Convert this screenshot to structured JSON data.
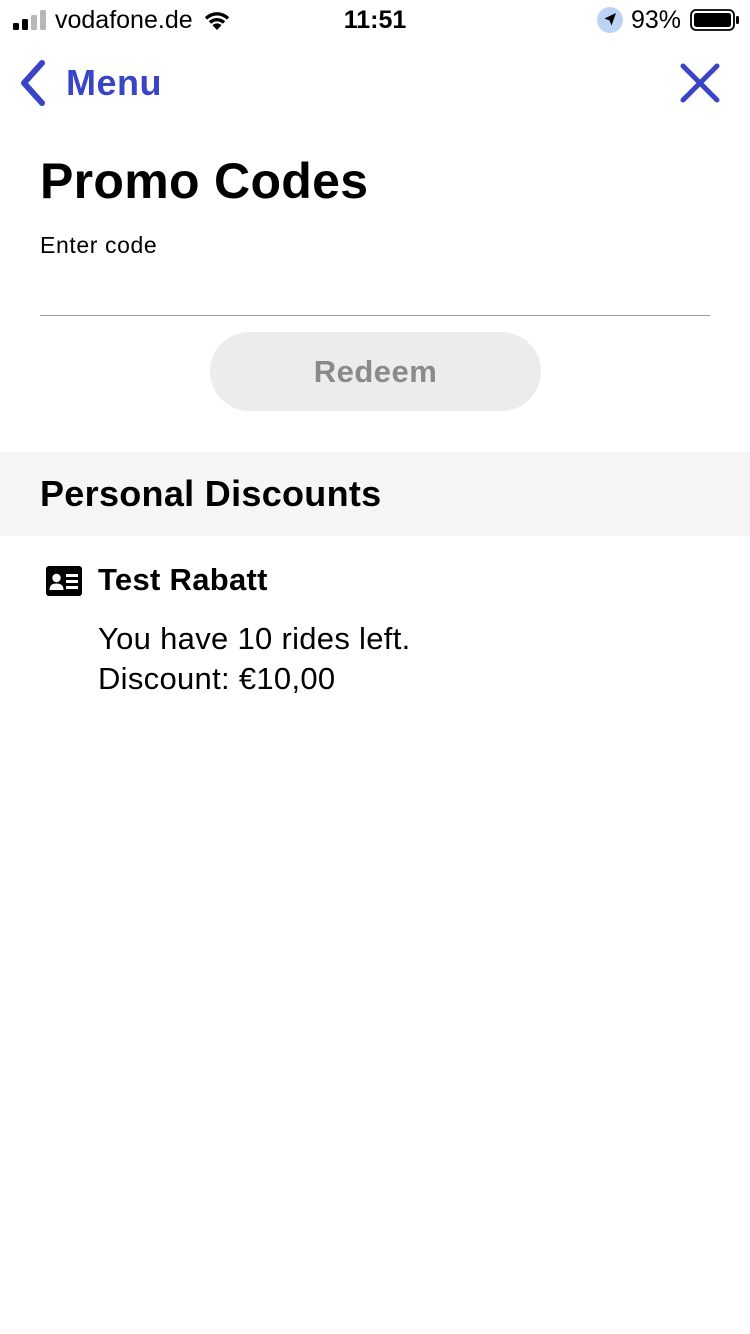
{
  "status_bar": {
    "carrier": "vodafone.de",
    "time": "11:51",
    "battery_percent": "93%",
    "signal_bars_active": 2,
    "signal_bars_total": 4,
    "battery_level": 0.93
  },
  "nav": {
    "back_label": "Menu",
    "back_icon": "chevron-left-icon",
    "close_icon": "close-icon",
    "accent_color": "#3a44c7"
  },
  "page": {
    "title": "Promo Codes",
    "code_field_label": "Enter code",
    "code_field_value": "",
    "redeem_label": "Redeem"
  },
  "personal_discounts": {
    "section_title": "Personal Discounts",
    "items": [
      {
        "icon": "id-card-icon",
        "name": "Test Rabatt",
        "rides_text": "You have 10 rides left.",
        "discount_text": "Discount: €10,00"
      }
    ]
  }
}
